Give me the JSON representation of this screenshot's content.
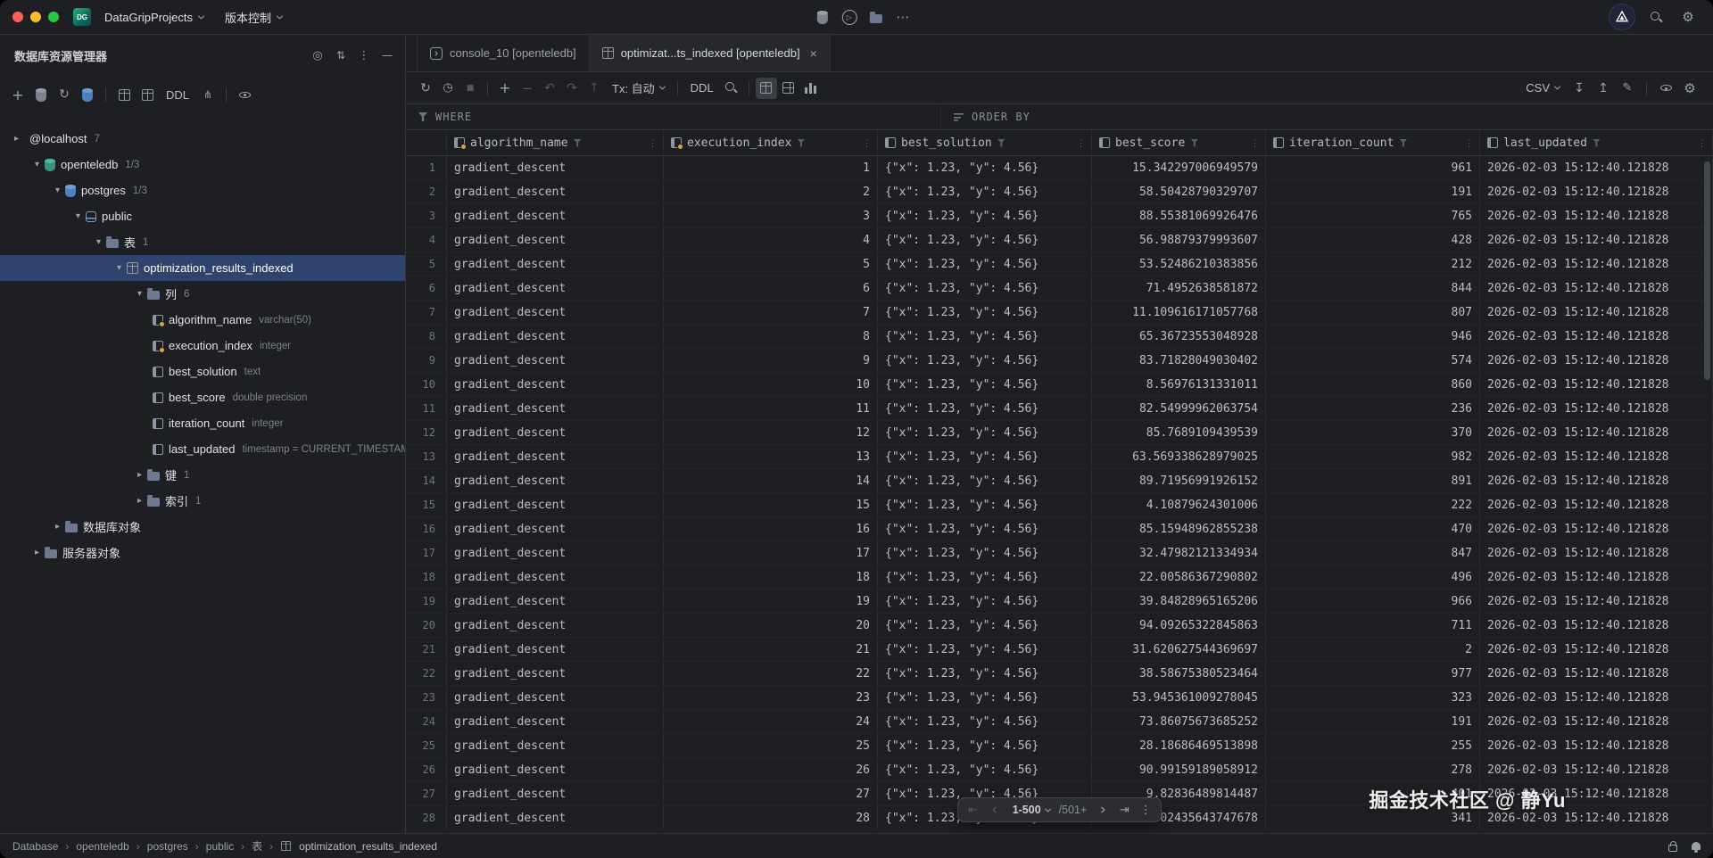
{
  "titlebar": {
    "logo_text": "DG",
    "project_selector": "DataGripProjects",
    "vcs_selector": "版本控制"
  },
  "sidebar": {
    "title": "数据库资源管理器",
    "toolbar_ddl": "DDL",
    "tree": [
      {
        "label": "@localhost",
        "meta": "7",
        "level": 0,
        "chevron": "right",
        "icon": "none",
        "selected": false
      },
      {
        "label": "openteledb",
        "meta": "1/3",
        "level": 1,
        "chevron": "down",
        "icon": "database",
        "selected": false
      },
      {
        "label": "postgres",
        "meta": "1/3",
        "level": 2,
        "chevron": "down",
        "icon": "database-blue",
        "selected": false
      },
      {
        "label": "public",
        "meta": "",
        "level": 3,
        "chevron": "down",
        "icon": "schema",
        "selected": false
      },
      {
        "label": "表",
        "meta": "1",
        "level": 4,
        "chevron": "down",
        "icon": "folder",
        "selected": false
      },
      {
        "label": "optimization_results_indexed",
        "meta": "",
        "level": 5,
        "chevron": "down",
        "icon": "table",
        "selected": true
      },
      {
        "label": "列",
        "meta": "6",
        "level": 6,
        "chevron": "down",
        "icon": "folder",
        "selected": false
      },
      {
        "label": "algorithm_name",
        "meta": "varchar(50)",
        "level": 7,
        "chevron": "none",
        "icon": "column-indexed",
        "selected": false
      },
      {
        "label": "execution_index",
        "meta": "integer",
        "level": 7,
        "chevron": "none",
        "icon": "column-indexed",
        "selected": false
      },
      {
        "label": "best_solution",
        "meta": "text",
        "level": 7,
        "chevron": "none",
        "icon": "column",
        "selected": false
      },
      {
        "label": "best_score",
        "meta": "double precision",
        "level": 7,
        "chevron": "none",
        "icon": "column",
        "selected": false
      },
      {
        "label": "iteration_count",
        "meta": "integer",
        "level": 7,
        "chevron": "none",
        "icon": "column",
        "selected": false
      },
      {
        "label": "last_updated",
        "meta": "timestamp = CURRENT_TIMESTAMP",
        "level": 7,
        "chevron": "none",
        "icon": "column",
        "selected": false
      },
      {
        "label": "键",
        "meta": "1",
        "level": 6,
        "chevron": "right",
        "icon": "folder",
        "selected": false
      },
      {
        "label": "索引",
        "meta": "1",
        "level": 6,
        "chevron": "right",
        "icon": "folder",
        "selected": false
      },
      {
        "label": "数据库对象",
        "meta": "",
        "level": 2,
        "chevron": "right",
        "icon": "folder",
        "selected": false
      },
      {
        "label": "服务器对象",
        "meta": "",
        "level": 1,
        "chevron": "right",
        "icon": "folder",
        "selected": false
      }
    ]
  },
  "tabs": [
    {
      "label": "console_10 [openteledb]",
      "icon": "console",
      "active": false,
      "closable": false
    },
    {
      "label": "optimizat...ts_indexed [openteledb]",
      "icon": "table",
      "active": true,
      "closable": true
    }
  ],
  "data_toolbar": {
    "tx_label": "Tx: 自动",
    "ddl_label": "DDL",
    "csv_label": "CSV"
  },
  "filter_bar": {
    "where_label": "WHERE",
    "order_by_label": "ORDER BY"
  },
  "grid": {
    "columns": [
      {
        "name": "algorithm_name",
        "indexed": true,
        "align": "left"
      },
      {
        "name": "execution_index",
        "indexed": true,
        "align": "right"
      },
      {
        "name": "best_solution",
        "indexed": false,
        "align": "left"
      },
      {
        "name": "best_score",
        "indexed": false,
        "align": "right"
      },
      {
        "name": "iteration_count",
        "indexed": false,
        "align": "right"
      },
      {
        "name": "last_updated",
        "indexed": false,
        "align": "left"
      }
    ],
    "rows": [
      [
        1,
        "gradient_descent",
        1,
        "{\"x\": 1.23, \"y\": 4.56}",
        "15.342297006949579",
        961,
        "2026-02-03 15:12:40.121828"
      ],
      [
        2,
        "gradient_descent",
        2,
        "{\"x\": 1.23, \"y\": 4.56}",
        "58.50428790329707",
        191,
        "2026-02-03 15:12:40.121828"
      ],
      [
        3,
        "gradient_descent",
        3,
        "{\"x\": 1.23, \"y\": 4.56}",
        "88.55381069926476",
        765,
        "2026-02-03 15:12:40.121828"
      ],
      [
        4,
        "gradient_descent",
        4,
        "{\"x\": 1.23, \"y\": 4.56}",
        "56.98879379993607",
        428,
        "2026-02-03 15:12:40.121828"
      ],
      [
        5,
        "gradient_descent",
        5,
        "{\"x\": 1.23, \"y\": 4.56}",
        "53.52486210383856",
        212,
        "2026-02-03 15:12:40.121828"
      ],
      [
        6,
        "gradient_descent",
        6,
        "{\"x\": 1.23, \"y\": 4.56}",
        "71.4952638581872",
        844,
        "2026-02-03 15:12:40.121828"
      ],
      [
        7,
        "gradient_descent",
        7,
        "{\"x\": 1.23, \"y\": 4.56}",
        "11.109616171057768",
        807,
        "2026-02-03 15:12:40.121828"
      ],
      [
        8,
        "gradient_descent",
        8,
        "{\"x\": 1.23, \"y\": 4.56}",
        "65.36723553048928",
        946,
        "2026-02-03 15:12:40.121828"
      ],
      [
        9,
        "gradient_descent",
        9,
        "{\"x\": 1.23, \"y\": 4.56}",
        "83.71828049030402",
        574,
        "2026-02-03 15:12:40.121828"
      ],
      [
        10,
        "gradient_descent",
        10,
        "{\"x\": 1.23, \"y\": 4.56}",
        "8.56976131331011",
        860,
        "2026-02-03 15:12:40.121828"
      ],
      [
        11,
        "gradient_descent",
        11,
        "{\"x\": 1.23, \"y\": 4.56}",
        "82.54999962063754",
        236,
        "2026-02-03 15:12:40.121828"
      ],
      [
        12,
        "gradient_descent",
        12,
        "{\"x\": 1.23, \"y\": 4.56}",
        "85.7689109439539",
        370,
        "2026-02-03 15:12:40.121828"
      ],
      [
        13,
        "gradient_descent",
        13,
        "{\"x\": 1.23, \"y\": 4.56}",
        "63.569338628979025",
        982,
        "2026-02-03 15:12:40.121828"
      ],
      [
        14,
        "gradient_descent",
        14,
        "{\"x\": 1.23, \"y\": 4.56}",
        "89.71956991926152",
        891,
        "2026-02-03 15:12:40.121828"
      ],
      [
        15,
        "gradient_descent",
        15,
        "{\"x\": 1.23, \"y\": 4.56}",
        "4.10879624301006",
        222,
        "2026-02-03 15:12:40.121828"
      ],
      [
        16,
        "gradient_descent",
        16,
        "{\"x\": 1.23, \"y\": 4.56}",
        "85.15948962855238",
        470,
        "2026-02-03 15:12:40.121828"
      ],
      [
        17,
        "gradient_descent",
        17,
        "{\"x\": 1.23, \"y\": 4.56}",
        "32.47982121334934",
        847,
        "2026-02-03 15:12:40.121828"
      ],
      [
        18,
        "gradient_descent",
        18,
        "{\"x\": 1.23, \"y\": 4.56}",
        "22.00586367290802",
        496,
        "2026-02-03 15:12:40.121828"
      ],
      [
        19,
        "gradient_descent",
        19,
        "{\"x\": 1.23, \"y\": 4.56}",
        "39.84828965165206",
        966,
        "2026-02-03 15:12:40.121828"
      ],
      [
        20,
        "gradient_descent",
        20,
        "{\"x\": 1.23, \"y\": 4.56}",
        "94.09265322845863",
        711,
        "2026-02-03 15:12:40.121828"
      ],
      [
        21,
        "gradient_descent",
        21,
        "{\"x\": 1.23, \"y\": 4.56}",
        "31.620627544369697",
        2,
        "2026-02-03 15:12:40.121828"
      ],
      [
        22,
        "gradient_descent",
        22,
        "{\"x\": 1.23, \"y\": 4.56}",
        "38.58675380523464",
        977,
        "2026-02-03 15:12:40.121828"
      ],
      [
        23,
        "gradient_descent",
        23,
        "{\"x\": 1.23, \"y\": 4.56}",
        "53.945361009278045",
        323,
        "2026-02-03 15:12:40.121828"
      ],
      [
        24,
        "gradient_descent",
        24,
        "{\"x\": 1.23, \"y\": 4.56}",
        "73.86075673685252",
        191,
        "2026-02-03 15:12:40.121828"
      ],
      [
        25,
        "gradient_descent",
        25,
        "{\"x\": 1.23, \"y\": 4.56}",
        "28.18686469513898",
        255,
        "2026-02-03 15:12:40.121828"
      ],
      [
        26,
        "gradient_descent",
        26,
        "{\"x\": 1.23, \"y\": 4.56}",
        "90.99159189058912",
        278,
        "2026-02-03 15:12:40.121828"
      ],
      [
        27,
        "gradient_descent",
        27,
        "{\"x\": 1.23, \"y\": 4.56}",
        "9.82836489814487",
        401,
        "2026-02-03 15:12:40.121828"
      ],
      [
        28,
        "gradient_descent",
        28,
        "{\"x\": 1.23, \"y\": 4.56}",
        "8.02435643747678",
        341,
        "2026-02-03 15:12:40.121828"
      ]
    ]
  },
  "pagination": {
    "range": "1-500",
    "total": "/501+"
  },
  "status_bar": {
    "breadcrumb": [
      "Database",
      "openteledb",
      "postgres",
      "public",
      "表",
      "optimization_results_indexed"
    ]
  },
  "watermark": "掘金技术社区 @ 静Yu"
}
